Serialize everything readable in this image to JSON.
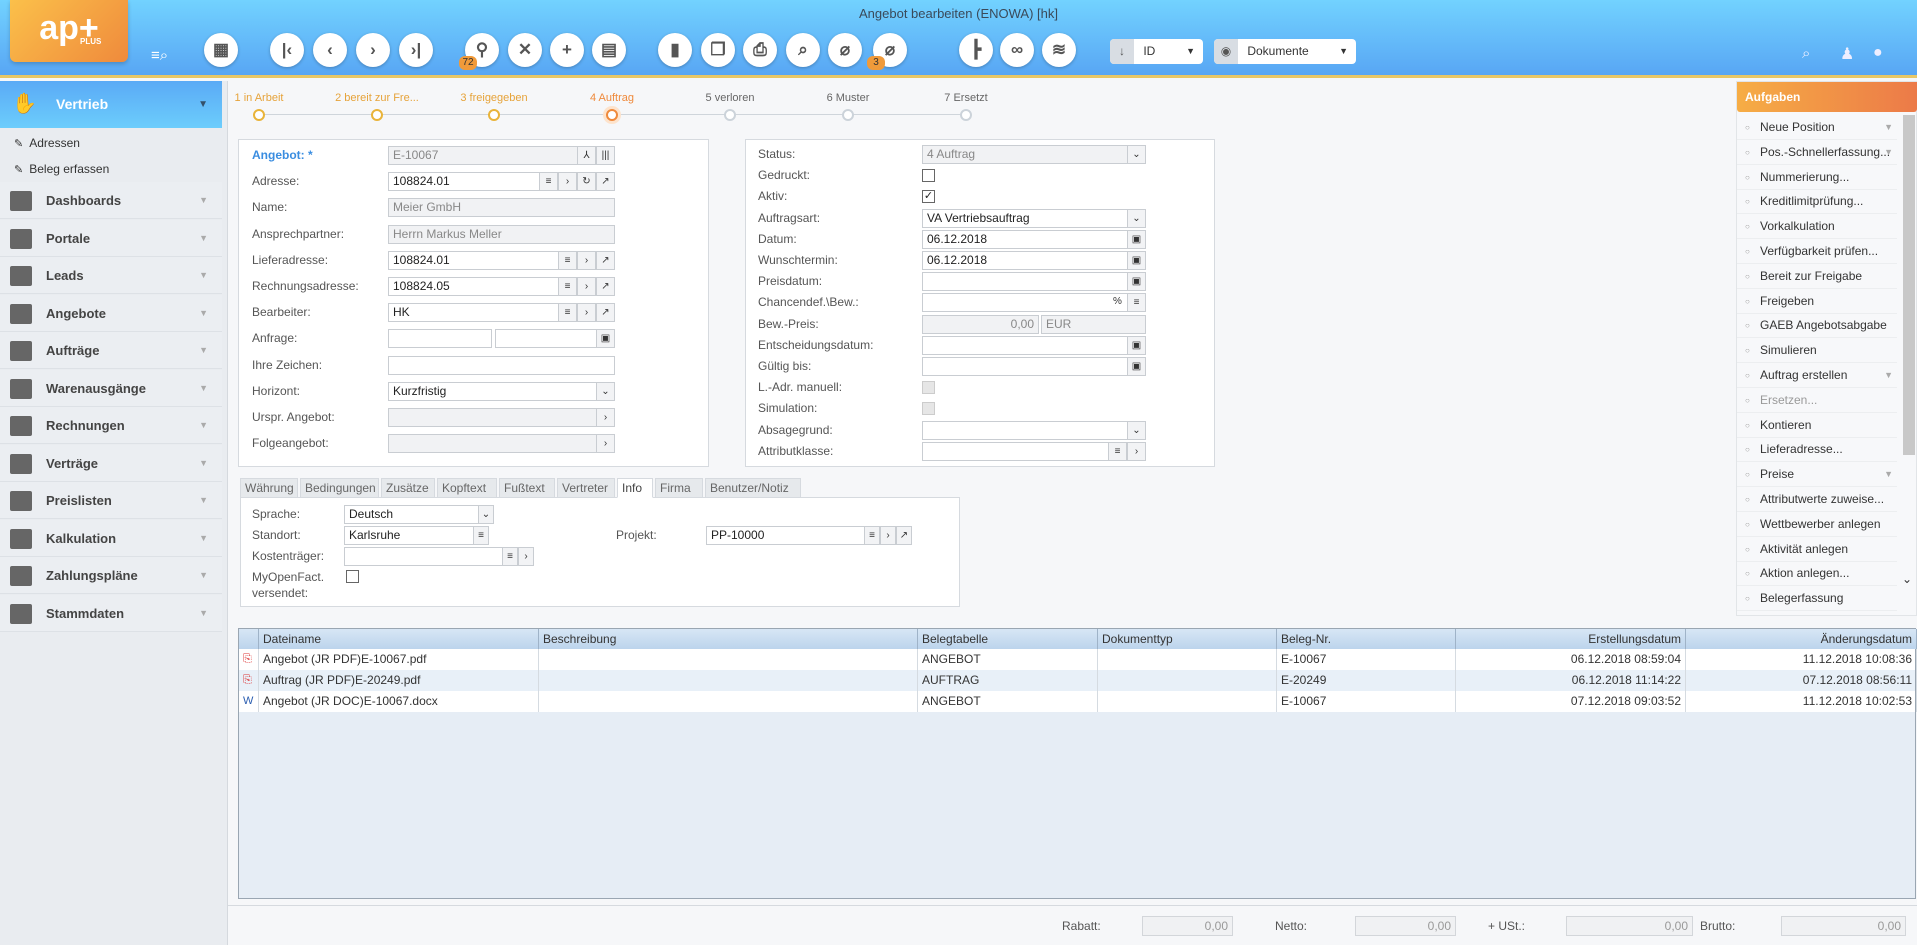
{
  "window_title": "Angebot bearbeiten (ENOWA) [hk]",
  "logo": {
    "text": "ap+",
    "sub": "PLUS"
  },
  "toolbar": {
    "buttons": [
      {
        "name": "grid-button",
        "glyph": "▦"
      },
      {
        "name": "first-record-button",
        "glyph": "|‹"
      },
      {
        "name": "prev-record-button",
        "glyph": "‹"
      },
      {
        "name": "next-record-button",
        "glyph": "›"
      },
      {
        "name": "last-record-button",
        "glyph": "›|"
      },
      {
        "name": "search-button",
        "glyph": "⚲",
        "badge": "72"
      },
      {
        "name": "cancel-button",
        "glyph": "✕"
      },
      {
        "name": "new-button",
        "glyph": "+"
      },
      {
        "name": "save-button",
        "glyph": "▤"
      },
      {
        "name": "delete-button",
        "glyph": "▮"
      },
      {
        "name": "copy-document-button",
        "glyph": "❐"
      },
      {
        "name": "print-button",
        "glyph": "⎙"
      },
      {
        "name": "preview-button",
        "glyph": "⌕"
      },
      {
        "name": "attachment-button",
        "glyph": "⌀"
      },
      {
        "name": "attachment-search-button",
        "glyph": "⌀",
        "badge": "3"
      },
      {
        "name": "hierarchy-button",
        "glyph": "┣"
      },
      {
        "name": "link-button",
        "glyph": "∞"
      },
      {
        "name": "feed-button",
        "glyph": "≋"
      }
    ],
    "sort_select": "ID",
    "view_select": "Dokumente"
  },
  "sidebar": {
    "header": "Vertrieb",
    "sub_items": [
      "Adressen",
      "Beleg erfassen"
    ],
    "items": [
      "Dashboards",
      "Portale",
      "Leads",
      "Angebote",
      "Aufträge",
      "Warenausgänge",
      "Rechnungen",
      "Verträge",
      "Preislisten",
      "Kalkulation",
      "Zahlungspläne",
      "Stammdaten"
    ]
  },
  "steps": [
    {
      "label": "1 in Arbeit",
      "state": "done"
    },
    {
      "label": "2 bereit zur Fre...",
      "state": "done"
    },
    {
      "label": "3 freigegeben",
      "state": "done"
    },
    {
      "label": "4 Auftrag",
      "state": "current"
    },
    {
      "label": "5 verloren",
      "state": "open"
    },
    {
      "label": "6 Muster",
      "state": "open"
    },
    {
      "label": "7 Ersetzt",
      "state": "open"
    }
  ],
  "form_left": [
    {
      "label": "Angebot: *",
      "value": "E-10067",
      "ro": true,
      "btns": [
        "⅄",
        "|||"
      ]
    },
    {
      "label": "Adresse:",
      "value": "108824.01",
      "btns": [
        "≡",
        "›",
        "↻",
        "↗"
      ]
    },
    {
      "label": "Name:",
      "value": "Meier GmbH",
      "ro": true,
      "btns": []
    },
    {
      "label": "Ansprechpartner:",
      "value": "Herrn Markus Meller",
      "ro": true,
      "btns": []
    },
    {
      "label": "Lieferadresse:",
      "value": "108824.01",
      "btns": [
        "≡",
        "›",
        "↗"
      ]
    },
    {
      "label": "Rechnungsadresse:",
      "value": "108824.05",
      "btns": [
        "≡",
        "›",
        "↗"
      ]
    },
    {
      "label": "Bearbeiter:",
      "value": "HK",
      "btns": [
        "≡",
        "›",
        "↗"
      ]
    },
    {
      "label": "Anfrage:",
      "value": "",
      "split": true,
      "btns": [
        "▣"
      ]
    },
    {
      "label": "Ihre Zeichen:",
      "value": "",
      "btns": []
    },
    {
      "label": "Horizont:",
      "value": "Kurzfristig",
      "btns": [
        "⌄"
      ]
    },
    {
      "label": "Urspr. Angebot:",
      "value": "",
      "ro": true,
      "btns": [
        "›"
      ]
    },
    {
      "label": "Folgeangebot:",
      "value": "",
      "ro": true,
      "btns": [
        "›"
      ]
    }
  ],
  "form_right": [
    {
      "label": "Status:",
      "value": "4 Auftrag",
      "ro": true,
      "btns": [
        "⌄"
      ]
    },
    {
      "label": "Gedruckt:",
      "check": false
    },
    {
      "label": "Aktiv:",
      "check": true
    },
    {
      "label": "Auftragsart:",
      "value": "VA Vertriebsauftrag",
      "btns": [
        "⌄"
      ]
    },
    {
      "label": "Datum:",
      "value": "06.12.2018",
      "btns": [
        "▣"
      ]
    },
    {
      "label": "Wunschtermin:",
      "value": "06.12.2018",
      "btns": [
        "▣"
      ]
    },
    {
      "label": "Preisdatum:",
      "value": "",
      "btns": [
        "▣"
      ]
    },
    {
      "label": "Chancendef.\\Bew.:",
      "value": "",
      "btns": [
        "%",
        "≡"
      ]
    },
    {
      "label": "Bew.-Preis:",
      "value": "0,00",
      "currency": "EUR",
      "ro": true
    },
    {
      "label": "Entscheidungsdatum:",
      "value": "",
      "btns": [
        "▣"
      ]
    },
    {
      "label": "Gültig bis:",
      "value": "",
      "btns": [
        "▣"
      ]
    },
    {
      "label": "L.-Adr. manuell:",
      "check": false,
      "disabled": true
    },
    {
      "label": "Simulation:",
      "check": false,
      "disabled": true
    },
    {
      "label": "Absagegrund:",
      "value": "",
      "btns": [
        "⌄"
      ]
    },
    {
      "label": "Attributklasse:",
      "value": "",
      "btns": [
        "≡",
        "›"
      ]
    }
  ],
  "tabs": [
    "Währung",
    "Bedingungen",
    "Zusätze",
    "Kopftext",
    "Fußtext",
    "Vertreter",
    "Info",
    "Firma",
    "Benutzer/Notiz"
  ],
  "active_tab": "Info",
  "info": {
    "sprache_label": "Sprache:",
    "sprache": "Deutsch",
    "standort_label": "Standort:",
    "standort": "Karlsruhe",
    "projekt_label": "Projekt:",
    "projekt": "PP-10000",
    "kostentraeger_label": "Kostenträger:",
    "kostentraeger": "",
    "myopenfact_label": "MyOpenFact.",
    "myopenfact_label2": "versendet:"
  },
  "documents": {
    "columns": [
      "Dateiname",
      "Beschreibung",
      "Belegtabelle",
      "Dokumenttyp",
      "Beleg-Nr.",
      "Erstellungsdatum",
      "Änderungsdatum"
    ],
    "rows": [
      {
        "icon": "pdf",
        "cells": [
          "Angebot (JR PDF)E-10067.pdf",
          "",
          "ANGEBOT",
          "",
          "E-10067",
          "06.12.2018 08:59:04",
          "11.12.2018 10:08:36"
        ]
      },
      {
        "icon": "pdf",
        "cells": [
          "Auftrag (JR PDF)E-20249.pdf",
          "",
          "AUFTRAG",
          "",
          "E-20249",
          "06.12.2018 11:14:22",
          "07.12.2018 08:56:11"
        ]
      },
      {
        "icon": "doc",
        "cells": [
          "Angebot (JR DOC)E-10067.docx",
          "",
          "ANGEBOT",
          "",
          "E-10067",
          "07.12.2018 09:03:52",
          "11.12.2018 10:02:53"
        ]
      }
    ]
  },
  "tasks": {
    "header": "Aufgaben",
    "items": [
      {
        "label": "Neue Position",
        "arrow": true
      },
      {
        "label": "Pos.-Schnellerfassung...",
        "arrow": true
      },
      {
        "label": "Nummerierung..."
      },
      {
        "label": "Kreditlimitprüfung..."
      },
      {
        "label": "Vorkalkulation"
      },
      {
        "label": "Verfügbarkeit prüfen..."
      },
      {
        "label": "Bereit zur Freigabe"
      },
      {
        "label": "Freigeben"
      },
      {
        "label": "GAEB Angebotsabgabe"
      },
      {
        "label": "Simulieren"
      },
      {
        "label": "Auftrag erstellen",
        "arrow": true
      },
      {
        "label": "Ersetzen...",
        "disabled": true
      },
      {
        "label": "Kontieren"
      },
      {
        "label": "Lieferadresse..."
      },
      {
        "label": "Preise",
        "arrow": true
      },
      {
        "label": "Attributwerte zuweise..."
      },
      {
        "label": "Wettbewerber anlegen"
      },
      {
        "label": "Aktivität anlegen"
      },
      {
        "label": "Aktion anlegen..."
      },
      {
        "label": "Belegerfassung"
      }
    ]
  },
  "totals": [
    {
      "label": "Rabatt:",
      "value": "0,00"
    },
    {
      "label": "Netto:",
      "value": "0,00"
    },
    {
      "label": "+ USt.:",
      "value": "0,00"
    },
    {
      "label": "Brutto:",
      "value": "0,00"
    }
  ]
}
